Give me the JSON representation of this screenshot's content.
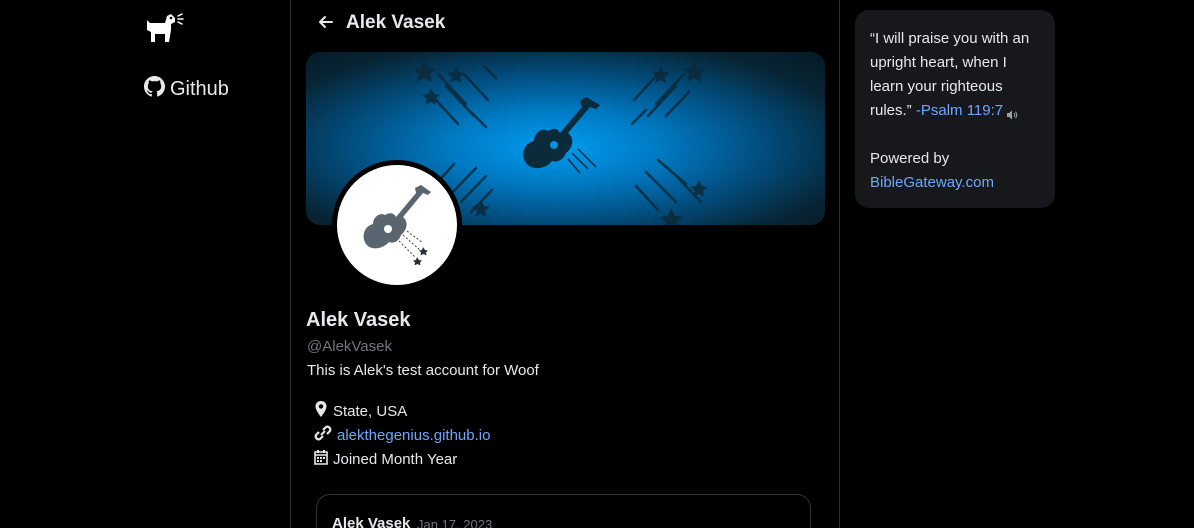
{
  "sidebar": {
    "logo_icon": "dog-icon",
    "github_label": "Github",
    "github_icon": "github-icon"
  },
  "header": {
    "back_icon": "arrow-left-icon",
    "title": "Alek Vasek"
  },
  "profile": {
    "banner_icon": "guitar-stars-icon",
    "avatar_icon": "guitar-stars-icon",
    "display_name": "Alek Vasek",
    "handle": "@AlekVasek",
    "bio": "This is Alek's test account for Woof",
    "location": "State, USA",
    "website": "alekthegenius.github.io",
    "joined": "Joined Month Year"
  },
  "post": {
    "author": "Alek Vasek",
    "date": "Jan 17, 2023"
  },
  "verse": {
    "text": "“I will praise you with an upright heart, when I learn your righteous rules.”",
    "reference": "-Psalm 119:7",
    "powered_by": "Powered by",
    "source": "BibleGateway.com"
  },
  "colors": {
    "background": "#000000",
    "link": "#6ea8fe",
    "banner_accent": "#009cf0",
    "card_bg": "#16181c"
  }
}
